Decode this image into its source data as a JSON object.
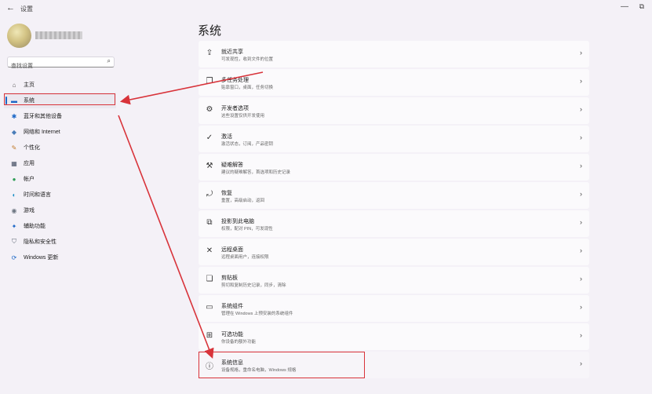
{
  "window": {
    "back_icon": "back-arrow-icon",
    "title": "设置",
    "minimize_glyph": "—",
    "maximize_glyph": "⧉"
  },
  "user": {
    "name": "••••••••"
  },
  "search": {
    "placeholder": "查找设置",
    "icon": "search-icon"
  },
  "sidebar": {
    "items": [
      {
        "label": "主页",
        "icon": "home-icon",
        "glyph": "⌂",
        "color": "#555555"
      },
      {
        "label": "系统",
        "icon": "monitor-icon",
        "glyph": "▬",
        "color": "#1a66c6",
        "selected": true
      },
      {
        "label": "蓝牙和其他设备",
        "icon": "bluetooth-icon",
        "glyph": "✱",
        "color": "#1a66c6"
      },
      {
        "label": "网络和 Internet",
        "icon": "wifi-icon",
        "glyph": "◆",
        "color": "#4a7db8"
      },
      {
        "label": "个性化",
        "icon": "brush-icon",
        "glyph": "✎",
        "color": "#c07a2a"
      },
      {
        "label": "应用",
        "icon": "apps-icon",
        "glyph": "▦",
        "color": "#444e63"
      },
      {
        "label": "帐户",
        "icon": "account-icon",
        "glyph": "●",
        "color": "#2e9d55"
      },
      {
        "label": "时间和语言",
        "icon": "globe-clock-icon",
        "glyph": "◐",
        "color": "#1a8fc6"
      },
      {
        "label": "游戏",
        "icon": "gamepad-icon",
        "glyph": "◉",
        "color": "#6b7480"
      },
      {
        "label": "辅助功能",
        "icon": "accessibility-icon",
        "glyph": "✦",
        "color": "#1a66c6"
      },
      {
        "label": "隐私和安全性",
        "icon": "shield-icon",
        "glyph": "⛉",
        "color": "#5b6472"
      },
      {
        "label": "Windows 更新",
        "icon": "update-icon",
        "glyph": "⟳",
        "color": "#1a66c6"
      }
    ]
  },
  "main": {
    "title": "系统",
    "cards": [
      {
        "title": "就近共享",
        "subtitle": "可发现性，收到文件的位置",
        "icon": "share-icon",
        "glyph": "⇪"
      },
      {
        "title": "多任务处理",
        "subtitle": "贴靠窗口，桌面，任务切换",
        "icon": "multitask-icon",
        "glyph": "❐"
      },
      {
        "title": "开发者选项",
        "subtitle": "这些设置仅供开发使用",
        "icon": "developer-icon",
        "glyph": "⚙"
      },
      {
        "title": "激活",
        "subtitle": "激活状态，订阅，产品密钥",
        "icon": "check-circle-icon",
        "glyph": "✓"
      },
      {
        "title": "疑难解答",
        "subtitle": "建议的疑难解答，首选项和历史记录",
        "icon": "wrench-icon",
        "glyph": "⚒"
      },
      {
        "title": "恢复",
        "subtitle": "重置，高级启动，返回",
        "icon": "recovery-icon",
        "glyph": "⤾"
      },
      {
        "title": "投影到此电脑",
        "subtitle": "权限，配对 PIN，可发现性",
        "icon": "project-icon",
        "glyph": "⧉"
      },
      {
        "title": "远程桌面",
        "subtitle": "远程桌面用户，连接权限",
        "icon": "remote-icon",
        "glyph": "✕"
      },
      {
        "title": "剪贴板",
        "subtitle": "剪切和复制历史记录，同步，清除",
        "icon": "clipboard-icon",
        "glyph": "❏"
      },
      {
        "title": "系统组件",
        "subtitle": "管理在 Windows 上预安装的系统组件",
        "icon": "components-icon",
        "glyph": "▭"
      },
      {
        "title": "可选功能",
        "subtitle": "你设备的额外功能",
        "icon": "optional-features-icon",
        "glyph": "⊞"
      },
      {
        "title": "系统信息",
        "subtitle": "设备规格，重命名电脑，Windows 规格",
        "icon": "info-icon",
        "glyph": "ⓘ"
      }
    ],
    "chevron": "›"
  },
  "annotation_color": "#d8333a"
}
